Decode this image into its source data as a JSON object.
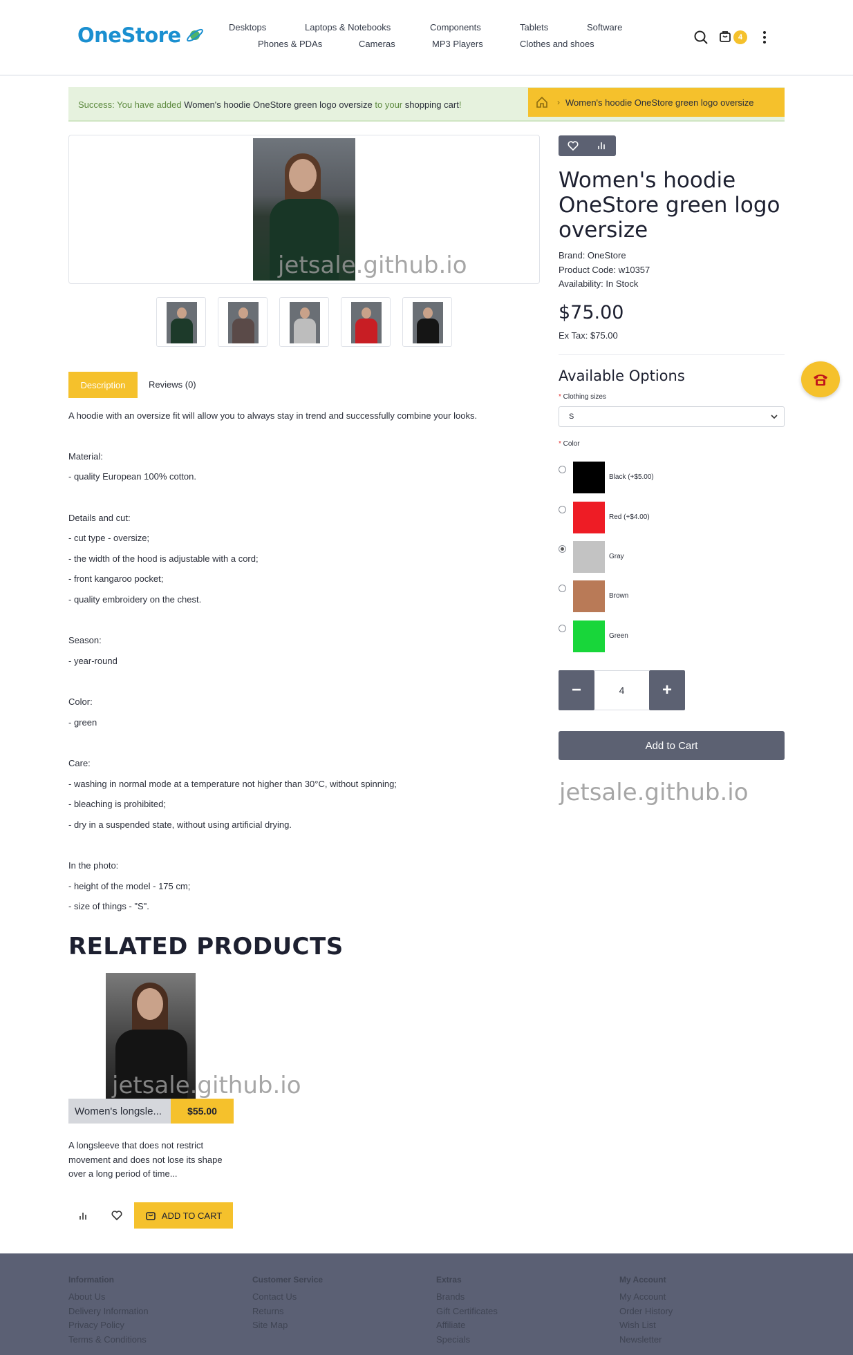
{
  "header": {
    "logo": "OneStore",
    "nav": [
      "Desktops",
      "Laptops & Notebooks",
      "Components",
      "Tablets",
      "Software",
      "Phones & PDAs",
      "Cameras",
      "MP3 Players",
      "Clothes and shoes"
    ],
    "cart_count": "4"
  },
  "alert": {
    "prefix": "Success: You have added",
    "product": "Women's hoodie OneStore green logo oversize",
    "suffix": "to your",
    "cart_link": "shopping cart",
    "end": "!"
  },
  "breadcrumb": {
    "current": "Women's hoodie OneStore green logo oversize"
  },
  "watermark": "jetsale.github.io",
  "tabs": {
    "description": "Description",
    "reviews": "Reviews (0)"
  },
  "description": [
    "A hoodie with an oversize fit will allow you to always stay in trend and successfully combine your looks.",
    "Material:",
    "- quality European 100% cotton.",
    "Details and cut:",
    "- cut type - oversize;",
    "- the width of the hood is adjustable with a cord;",
    "- front kangaroo pocket;",
    "- quality embroidery on the chest.",
    "Season:",
    "- year-round",
    "Color:",
    "- green",
    "Care:",
    "- washing in normal mode at a temperature not higher than 30°C, without spinning;",
    "- bleaching is prohibited;",
    "- dry in a suspended state, without using artificial drying.",
    "In the photo:",
    "- height of the model - 175 cm;",
    "- size of things - \"S\"."
  ],
  "product": {
    "title": "Women's hoodie OneStore green logo oversize",
    "brand": "Brand: OneStore",
    "code": "Product Code: w10357",
    "availability": "Availability: In Stock",
    "price": "$75.00",
    "ex_tax": "Ex Tax: $75.00"
  },
  "options": {
    "title": "Available Options",
    "size_label": "Clothing sizes",
    "size_value": "S",
    "color_label": "Color",
    "colors": [
      {
        "label": "Black (+$5.00)",
        "hex": "#000000",
        "selected": false
      },
      {
        "label": "Red (+$4.00)",
        "hex": "#ee1c25",
        "selected": false
      },
      {
        "label": "Gray",
        "hex": "#c3c3c3",
        "selected": true
      },
      {
        "label": "Brown",
        "hex": "#b97a57",
        "selected": false
      },
      {
        "label": "Green",
        "hex": "#18d63a",
        "selected": false
      }
    ]
  },
  "quantity": {
    "minus": "−",
    "value": "4",
    "plus": "+"
  },
  "add_to_cart": "Add to Cart",
  "related": {
    "title": "RELATED PRODUCTS",
    "items": [
      {
        "name": "Women's longsle...",
        "price": "$55.00",
        "description": "A longsleeve that does not restrict movement and does not lose its shape over a long period of time...",
        "add_label": "ADD TO CART"
      }
    ]
  },
  "footer": {
    "columns": [
      {
        "heading": "Information",
        "links": [
          "About Us",
          "Delivery Information",
          "Privacy Policy",
          "Terms & Conditions"
        ]
      },
      {
        "heading": "Customer Service",
        "links": [
          "Contact Us",
          "Returns",
          "Site Map"
        ]
      },
      {
        "heading": "Extras",
        "links": [
          "Brands",
          "Gift Certificates",
          "Affiliate",
          "Specials"
        ]
      },
      {
        "heading": "My Account",
        "links": [
          "My Account",
          "Order History",
          "Wish List",
          "Newsletter"
        ]
      }
    ]
  },
  "colors": {
    "accent": "#f5c12c",
    "dark_button": "#5c6172",
    "brand_blue": "#1a8fd0",
    "footer_bg": "#5b6074"
  }
}
